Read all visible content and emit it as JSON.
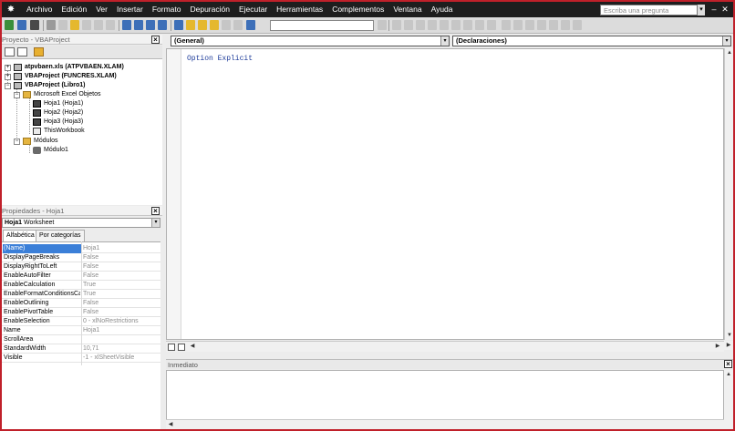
{
  "menu": {
    "items": [
      "Archivo",
      "Edición",
      "Ver",
      "Insertar",
      "Formato",
      "Depuración",
      "Ejecutar",
      "Herramientas",
      "Complementos",
      "Ventana",
      "Ayuda"
    ],
    "help_placeholder": "Escriba una pregunta"
  },
  "project": {
    "title": "Proyecto - VBAProject",
    "nodes": [
      "atpvbaen.xls (ATPVBAEN.XLAM)",
      "VBAProject (FUNCRES.XLAM)",
      "VBAProject (Libro1)",
      "Microsoft Excel Objetos",
      "Hoja1 (Hoja1)",
      "Hoja2 (Hoja2)",
      "Hoja3 (Hoja3)",
      "ThisWorkbook",
      "Módulos",
      "Módulo1"
    ]
  },
  "properties": {
    "title": "Propiedades - Hoja1",
    "object_name": "Hoja1",
    "object_type": "Worksheet",
    "tabs": [
      "Alfabética",
      "Por categorías"
    ],
    "rows": [
      {
        "name": "(Name)",
        "value": "Hoja1"
      },
      {
        "name": "DisplayPageBreaks",
        "value": "False"
      },
      {
        "name": "DisplayRightToLeft",
        "value": "False"
      },
      {
        "name": "EnableAutoFilter",
        "value": "False"
      },
      {
        "name": "EnableCalculation",
        "value": "True"
      },
      {
        "name": "EnableFormatConditionsCalc",
        "value": "True"
      },
      {
        "name": "EnableOutlining",
        "value": "False"
      },
      {
        "name": "EnablePivotTable",
        "value": "False"
      },
      {
        "name": "EnableSelection",
        "value": "0 - xlNoRestrictions"
      },
      {
        "name": "Name",
        "value": "Hoja1"
      },
      {
        "name": "ScrollArea",
        "value": ""
      },
      {
        "name": "StandardWidth",
        "value": "10,71"
      },
      {
        "name": "Visible",
        "value": "-1 - xlSheetVisible"
      }
    ]
  },
  "code": {
    "object_combo": "(General)",
    "proc_combo": "(Declaraciones)",
    "lines": [
      "Option Explicit"
    ]
  },
  "immediate": {
    "title": "Inmediato"
  },
  "colors": {
    "window_border": "#c0202a",
    "selection": "#3b7fd8",
    "keyword": "#1e3c9a"
  }
}
